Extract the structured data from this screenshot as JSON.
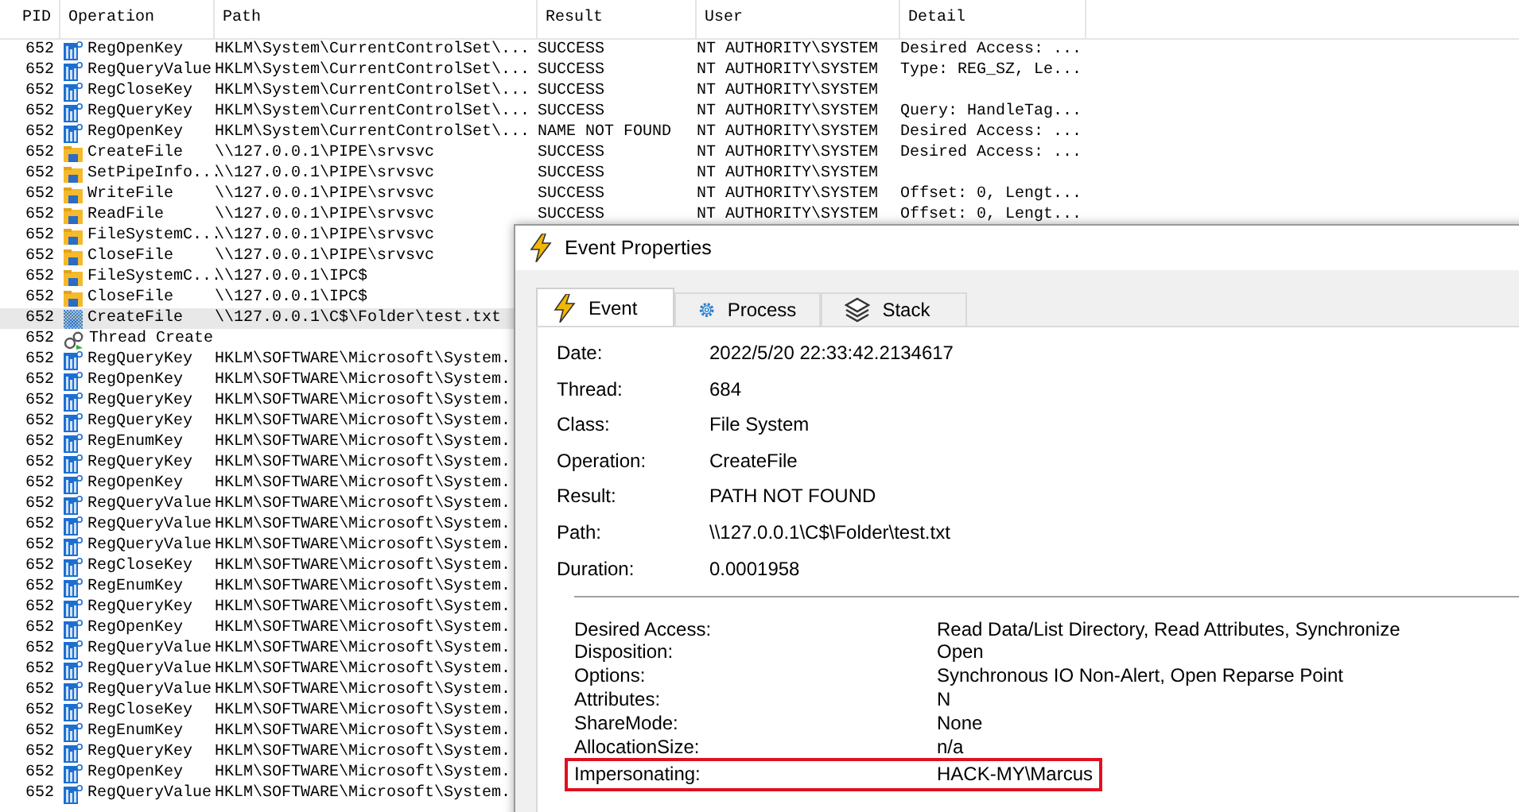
{
  "columns": [
    "PID",
    "Operation",
    "Path",
    "Result",
    "User",
    "Detail"
  ],
  "rows": [
    {
      "pid": "652",
      "kind": "registry",
      "operation": "RegOpenKey",
      "path": "HKLM\\System\\CurrentControlSet\\...",
      "result": "SUCCESS",
      "user": "NT AUTHORITY\\SYSTEM",
      "detail": "Desired Access: ...",
      "selected": false
    },
    {
      "pid": "652",
      "kind": "registry",
      "operation": "RegQueryValue",
      "path": "HKLM\\System\\CurrentControlSet\\...",
      "result": "SUCCESS",
      "user": "NT AUTHORITY\\SYSTEM",
      "detail": "Type: REG_SZ, Le...",
      "selected": false
    },
    {
      "pid": "652",
      "kind": "registry",
      "operation": "RegCloseKey",
      "path": "HKLM\\System\\CurrentControlSet\\...",
      "result": "SUCCESS",
      "user": "NT AUTHORITY\\SYSTEM",
      "selected": false
    },
    {
      "pid": "652",
      "kind": "registry",
      "operation": "RegQueryKey",
      "path": "HKLM\\System\\CurrentControlSet\\...",
      "result": "SUCCESS",
      "user": "NT AUTHORITY\\SYSTEM",
      "detail": "Query: HandleTag...",
      "selected": false
    },
    {
      "pid": "652",
      "kind": "registry",
      "operation": "RegOpenKey",
      "path": "HKLM\\System\\CurrentControlSet\\...",
      "result": "NAME NOT FOUND",
      "user": "NT AUTHORITY\\SYSTEM",
      "detail": "Desired Access: ...",
      "selected": false
    },
    {
      "pid": "652",
      "kind": "file",
      "operation": "CreateFile",
      "path": "\\\\127.0.0.1\\PIPE\\srvsvc",
      "result": "SUCCESS",
      "user": "NT AUTHORITY\\SYSTEM",
      "detail": "Desired Access: ...",
      "selected": false
    },
    {
      "pid": "652",
      "kind": "file",
      "operation": "SetPipeInfo...",
      "path": "\\\\127.0.0.1\\PIPE\\srvsvc",
      "result": "SUCCESS",
      "user": "NT AUTHORITY\\SYSTEM",
      "selected": false
    },
    {
      "pid": "652",
      "kind": "file",
      "operation": "WriteFile",
      "path": "\\\\127.0.0.1\\PIPE\\srvsvc",
      "result": "SUCCESS",
      "user": "NT AUTHORITY\\SYSTEM",
      "detail": "Offset: 0, Lengt...",
      "selected": false
    },
    {
      "pid": "652",
      "kind": "file",
      "operation": "ReadFile",
      "path": "\\\\127.0.0.1\\PIPE\\srvsvc",
      "result": "SUCCESS",
      "user": "NT AUTHORITY\\SYSTEM",
      "detail": "Offset: 0, Lengt...",
      "selected": false
    },
    {
      "pid": "652",
      "kind": "file",
      "operation": "FileSystemC...",
      "path": "\\\\127.0.0.1\\PIPE\\srvsvc",
      "selected": false
    },
    {
      "pid": "652",
      "kind": "file",
      "operation": "CloseFile",
      "path": "\\\\127.0.0.1\\PIPE\\srvsvc",
      "selected": false
    },
    {
      "pid": "652",
      "kind": "file",
      "operation": "FileSystemC...",
      "path": "\\\\127.0.0.1\\IPC$",
      "selected": false
    },
    {
      "pid": "652",
      "kind": "file",
      "operation": "CloseFile",
      "path": "\\\\127.0.0.1\\IPC$",
      "selected": false
    },
    {
      "pid": "652",
      "kind": "file",
      "operation": "CreateFile",
      "path": "\\\\127.0.0.1\\C$\\Folder\\test.txt",
      "selected": true
    },
    {
      "pid": "652",
      "kind": "thread",
      "operation": "Thread Create",
      "selected": false
    },
    {
      "pid": "652",
      "kind": "registry",
      "operation": "RegQueryKey",
      "path": "HKLM\\SOFTWARE\\Microsoft\\System.",
      "selected": false
    },
    {
      "pid": "652",
      "kind": "registry",
      "operation": "RegOpenKey",
      "path": "HKLM\\SOFTWARE\\Microsoft\\System.",
      "selected": false
    },
    {
      "pid": "652",
      "kind": "registry",
      "operation": "RegQueryKey",
      "path": "HKLM\\SOFTWARE\\Microsoft\\System.",
      "selected": false
    },
    {
      "pid": "652",
      "kind": "registry",
      "operation": "RegQueryKey",
      "path": "HKLM\\SOFTWARE\\Microsoft\\System.",
      "selected": false
    },
    {
      "pid": "652",
      "kind": "registry",
      "operation": "RegEnumKey",
      "path": "HKLM\\SOFTWARE\\Microsoft\\System.",
      "selected": false
    },
    {
      "pid": "652",
      "kind": "registry",
      "operation": "RegQueryKey",
      "path": "HKLM\\SOFTWARE\\Microsoft\\System.",
      "selected": false
    },
    {
      "pid": "652",
      "kind": "registry",
      "operation": "RegOpenKey",
      "path": "HKLM\\SOFTWARE\\Microsoft\\System.",
      "selected": false
    },
    {
      "pid": "652",
      "kind": "registry",
      "operation": "RegQueryValue",
      "path": "HKLM\\SOFTWARE\\Microsoft\\System.",
      "selected": false
    },
    {
      "pid": "652",
      "kind": "registry",
      "operation": "RegQueryValue",
      "path": "HKLM\\SOFTWARE\\Microsoft\\System.",
      "selected": false
    },
    {
      "pid": "652",
      "kind": "registry",
      "operation": "RegQueryValue",
      "path": "HKLM\\SOFTWARE\\Microsoft\\System.",
      "selected": false
    },
    {
      "pid": "652",
      "kind": "registry",
      "operation": "RegCloseKey",
      "path": "HKLM\\SOFTWARE\\Microsoft\\System.",
      "selected": false
    },
    {
      "pid": "652",
      "kind": "registry",
      "operation": "RegEnumKey",
      "path": "HKLM\\SOFTWARE\\Microsoft\\System.",
      "selected": false
    },
    {
      "pid": "652",
      "kind": "registry",
      "operation": "RegQueryKey",
      "path": "HKLM\\SOFTWARE\\Microsoft\\System.",
      "selected": false
    },
    {
      "pid": "652",
      "kind": "registry",
      "operation": "RegOpenKey",
      "path": "HKLM\\SOFTWARE\\Microsoft\\System.",
      "selected": false
    },
    {
      "pid": "652",
      "kind": "registry",
      "operation": "RegQueryValue",
      "path": "HKLM\\SOFTWARE\\Microsoft\\System.",
      "selected": false
    },
    {
      "pid": "652",
      "kind": "registry",
      "operation": "RegQueryValue",
      "path": "HKLM\\SOFTWARE\\Microsoft\\System.",
      "selected": false
    },
    {
      "pid": "652",
      "kind": "registry",
      "operation": "RegQueryValue",
      "path": "HKLM\\SOFTWARE\\Microsoft\\System.",
      "selected": false
    },
    {
      "pid": "652",
      "kind": "registry",
      "operation": "RegCloseKey",
      "path": "HKLM\\SOFTWARE\\Microsoft\\System.",
      "selected": false
    },
    {
      "pid": "652",
      "kind": "registry",
      "operation": "RegEnumKey",
      "path": "HKLM\\SOFTWARE\\Microsoft\\System.",
      "selected": false
    },
    {
      "pid": "652",
      "kind": "registry",
      "operation": "RegQueryKey",
      "path": "HKLM\\SOFTWARE\\Microsoft\\System.",
      "selected": false
    },
    {
      "pid": "652",
      "kind": "registry",
      "operation": "RegOpenKey",
      "path": "HKLM\\SOFTWARE\\Microsoft\\System.",
      "selected": false
    },
    {
      "pid": "652",
      "kind": "registry",
      "operation": "RegQueryValue",
      "path": "HKLM\\SOFTWARE\\Microsoft\\System.",
      "selected": false
    }
  ],
  "dialog": {
    "title": "Event Properties",
    "tabs": [
      {
        "label": "Event",
        "selected": true
      },
      {
        "label": "Process",
        "selected": false
      },
      {
        "label": "Stack",
        "selected": false
      }
    ],
    "properties": [
      {
        "label": "Date:",
        "value": "2022/5/20 22:33:42.2134617"
      },
      {
        "label": "Thread:",
        "value": "684"
      },
      {
        "label": "Class:",
        "value": "File System"
      },
      {
        "label": "Operation:",
        "value": "CreateFile"
      },
      {
        "label": "Result:",
        "value": "PATH NOT FOUND"
      },
      {
        "label": "Path:",
        "value": "\\\\127.0.0.1\\C$\\Folder\\test.txt"
      },
      {
        "label": "Duration:",
        "value": "0.0001958"
      }
    ],
    "details": [
      {
        "label": "Desired Access:",
        "value": "Read Data/List Directory, Read Attributes, Synchronize",
        "highlighted": false
      },
      {
        "label": "Disposition:",
        "value": "Open",
        "highlighted": false
      },
      {
        "label": "Options:",
        "value": "Synchronous IO Non-Alert, Open Reparse Point",
        "highlighted": false
      },
      {
        "label": "Attributes:",
        "value": "N",
        "highlighted": false
      },
      {
        "label": "ShareMode:",
        "value": "None",
        "highlighted": false
      },
      {
        "label": "AllocationSize:",
        "value": "n/a",
        "highlighted": false
      },
      {
        "label": "Impersonating:",
        "value": "HACK-MY\\Marcus",
        "highlighted": true
      }
    ]
  }
}
